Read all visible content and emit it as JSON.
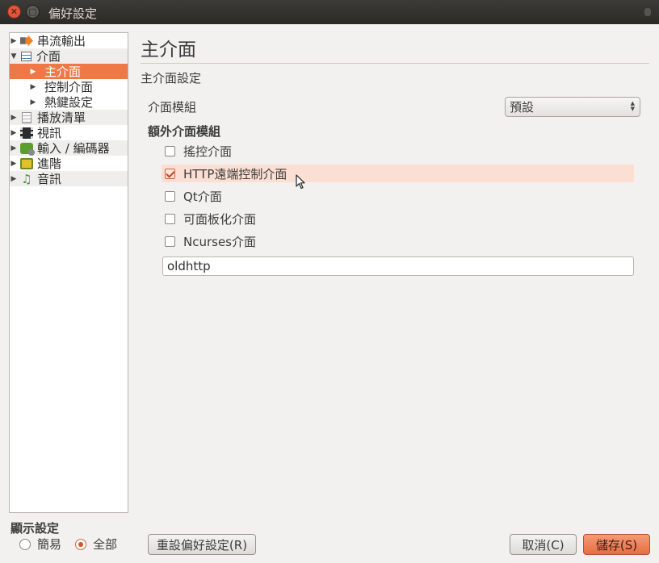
{
  "window": {
    "title": "偏好設定"
  },
  "tree": {
    "items": [
      {
        "label": "串流輸出",
        "arrow": "▶",
        "icon": "stream-output-icon"
      },
      {
        "label": "介面",
        "arrow": "▼",
        "icon": "interface-icon"
      },
      {
        "label": "主介面",
        "arrow": "▶",
        "icon": ""
      },
      {
        "label": "控制介面",
        "arrow": "▶",
        "icon": ""
      },
      {
        "label": "熱鍵設定",
        "arrow": "▶",
        "icon": ""
      },
      {
        "label": "播放清單",
        "arrow": "▶",
        "icon": "playlist-icon"
      },
      {
        "label": "視訊",
        "arrow": "▶",
        "icon": "video-icon"
      },
      {
        "label": "輸入 / 編碼器",
        "arrow": "▶",
        "icon": "codec-icon"
      },
      {
        "label": "進階",
        "arrow": "▶",
        "icon": "advanced-icon"
      },
      {
        "label": "音訊",
        "arrow": "▶",
        "icon": "audio-icon"
      }
    ],
    "selected": "主介面"
  },
  "main": {
    "page_title": "主介面",
    "section_title": "主介面設定",
    "module_label": "介面模組",
    "module_value": "預設",
    "extra_title": "額外介面模組",
    "extra_modules": [
      {
        "label": "搖控介面",
        "checked": false
      },
      {
        "label": "HTTP遠端控制介面",
        "checked": true
      },
      {
        "label": "Qt介面",
        "checked": false
      },
      {
        "label": "可面板化介面",
        "checked": false
      },
      {
        "label": "Ncurses介面",
        "checked": false
      }
    ],
    "extra_modules_value": "oldhttp"
  },
  "footer": {
    "show_settings_title": "顯示設定",
    "radio_simple": "簡易",
    "radio_all": "全部",
    "selected_mode": "全部",
    "reset_label": "重設偏好設定(R)",
    "cancel_label": "取消(C)",
    "save_label": "儲存(S)"
  },
  "colors": {
    "accent": "#f07746",
    "hover_row": "#fbdfd3",
    "titlebar": "#2b2a27"
  }
}
